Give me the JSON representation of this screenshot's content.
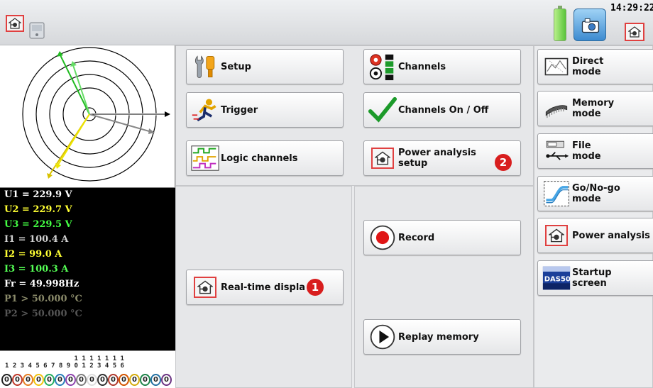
{
  "header": {
    "clock": "14:29:22"
  },
  "measurements": [
    {
      "text": "U1 =  229.9 V",
      "color": "#ffffff"
    },
    {
      "text": "U2 =  229.7 V",
      "color": "#ffff33"
    },
    {
      "text": "U3 =  229.5 V",
      "color": "#44ff44"
    },
    {
      "text": "I1 =  100.4 A",
      "color": "#cfcfcf"
    },
    {
      "text": "I2 =  99.0 A",
      "color": "#ffff33"
    },
    {
      "text": "I3 =  100.3 A",
      "color": "#55ff55"
    },
    {
      "text": "Fr = 49.998Hz",
      "color": "#ffffff"
    },
    {
      "text": "P1 > 50.000 °C",
      "color": "#8a8a6a"
    },
    {
      "text": "P2 > 50.000 °C",
      "color": "#555555"
    }
  ],
  "channels": {
    "tens_row": "                  1 1 1 1 1 1 1",
    "units_row": "1 2 3 4 5 6 7 8 9 0 1 2 3 4 5 6",
    "values": [
      "0",
      "0",
      "0",
      "0",
      "0",
      "0",
      "0",
      "0",
      "0",
      "0",
      "0",
      "0",
      "0",
      "0",
      "0",
      "0"
    ],
    "dot_colors": [
      "#222222",
      "#c0392b",
      "#e67e22",
      "#f1c40f",
      "#27ae60",
      "#2980b9",
      "#8e44ad",
      "#7f7f7f",
      "#dddddd",
      "#333333",
      "#b03a2e",
      "#d35400",
      "#d4ac0d",
      "#1e8449",
      "#2471a3",
      "#6c3483"
    ]
  },
  "menu": {
    "setup": "Setup",
    "trigger": "Trigger",
    "logic_channels": "Logic channels",
    "channels": "Channels",
    "channels_on_off": "Channels On / Off",
    "power_analysis_setup_1": "Power analysis",
    "power_analysis_setup_2": "setup",
    "realtime_display": "Real-time displa",
    "record": "Record",
    "replay_memory": "Replay memory",
    "direct_mode_1": "Direct",
    "direct_mode_2": "mode",
    "memory_mode_1": "Memory",
    "memory_mode_2": "mode",
    "file_mode_1": "File",
    "file_mode_2": "mode",
    "gonogo_mode_1": "Go/No-go",
    "gonogo_mode_2": "mode",
    "power_analysis": "Power analysis",
    "startup_screen_1": "Startup",
    "startup_screen_2": "screen",
    "badge_1": "1",
    "badge_2": "2",
    "startup_thumb_text": "DAS50"
  },
  "colors": {
    "accent_red": "#d81e1e",
    "home_border": "#e04040"
  }
}
